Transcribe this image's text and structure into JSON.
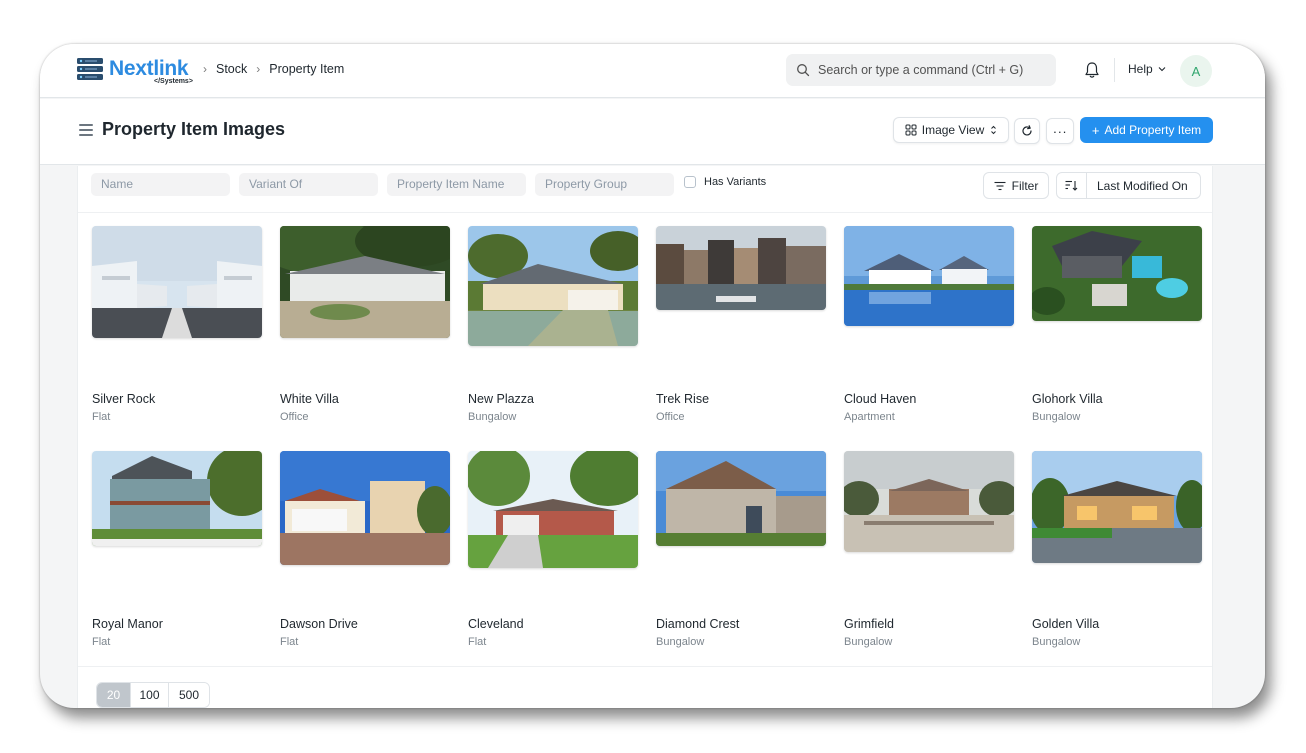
{
  "app": {
    "logo_text": "Nextlink",
    "logo_sub": "</Systems>",
    "brand_color": "#2d8be0"
  },
  "breadcrumbs": [
    "Stock",
    "Property Item"
  ],
  "search": {
    "placeholder": "Search or type a command (Ctrl + G)"
  },
  "navbar": {
    "help_label": "Help",
    "avatar_initial": "A"
  },
  "page": {
    "title": "Property Item Images",
    "view_label": "Image View",
    "more_label": "···",
    "add_label": "Add Property Item",
    "accent": "#2490ef"
  },
  "filters": {
    "fields": [
      "Name",
      "Variant Of",
      "Property Item Name",
      "Property Group"
    ],
    "checkbox_label": "Has Variants",
    "filter_label": "Filter",
    "sort_label": "Last Modified On"
  },
  "items": [
    {
      "name": "Silver Rock",
      "group": "Flat",
      "scene": "street"
    },
    {
      "name": "White Villa",
      "group": "Office",
      "scene": "villa"
    },
    {
      "name": "New Plazza",
      "group": "Bungalow",
      "scene": "bungalow"
    },
    {
      "name": "Trek Rise",
      "group": "Office",
      "scene": "canal"
    },
    {
      "name": "Cloud Haven",
      "group": "Apartment",
      "scene": "lake"
    },
    {
      "name": "Glohork Villa",
      "group": "Bungalow",
      "scene": "pool"
    },
    {
      "name": "Royal Manor",
      "group": "Flat",
      "scene": "victorian"
    },
    {
      "name": "Dawson Drive",
      "group": "Flat",
      "scene": "stucco"
    },
    {
      "name": "Cleveland",
      "group": "Flat",
      "scene": "ranch"
    },
    {
      "name": "Diamond Crest",
      "group": "Bungalow",
      "scene": "cottage"
    },
    {
      "name": "Grimfield",
      "group": "Bungalow",
      "scene": "palace"
    },
    {
      "name": "Golden Villa",
      "group": "Bungalow",
      "scene": "dusk"
    }
  ],
  "paging": [
    "20",
    "100",
    "500"
  ]
}
